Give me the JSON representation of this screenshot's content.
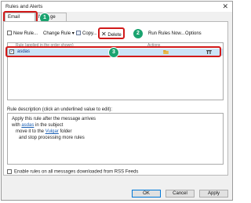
{
  "window": {
    "title": "Rules and Alerts",
    "close_glyph": "✕"
  },
  "tabs": [
    {
      "label": "Email Rules",
      "active": true
    },
    {
      "label": "Manage Alerts",
      "active": false
    }
  ],
  "toolbar": {
    "new_rule": "New Rule...",
    "change_rule": "Change Rule",
    "copy": "Copy...",
    "delete": "Delete",
    "run_rules_now": "Run Rules Now...",
    "options": "Options"
  },
  "rules_list": {
    "header_rule": "Rule (applied in the order shown)",
    "header_actions": "Actions",
    "rows": [
      {
        "name": "asdas",
        "checked": true
      }
    ]
  },
  "description": {
    "label": "Rule description (click an underlined value to edit):",
    "lines": {
      "l1": "Apply this rule after the message arrives",
      "l2_prefix": "with ",
      "l2_link": "asdas",
      "l2_suffix": " in the subject",
      "l3_prefix": "move it to the ",
      "l3_link": "Vulgar",
      "l3_suffix": " folder",
      "l4": "and stop processing more rules"
    }
  },
  "rss_option": {
    "label": "Enable rules on all messages downloaded from RSS Feeds",
    "checked": false
  },
  "buttons": {
    "ok": "OK",
    "cancel": "Cancel",
    "apply": "Apply"
  },
  "callouts": {
    "c1": "1",
    "c2": "2",
    "c3": "3"
  },
  "colors": {
    "highlight": "#d11a1a",
    "badge": "#1aa36f",
    "selection": "#cce4f7",
    "link": "#1a5fb4"
  }
}
